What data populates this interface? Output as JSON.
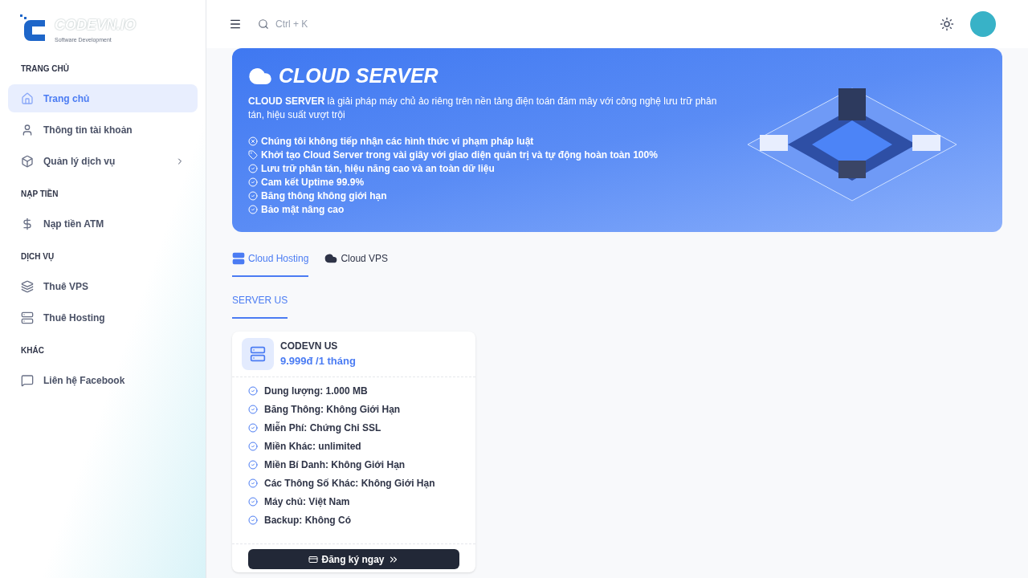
{
  "logo": {
    "name": "CODEVN.IO",
    "tagline": "Software Development"
  },
  "sidebar": {
    "sections": [
      {
        "title": "TRANG CHỦ",
        "items": [
          {
            "label": "Trang chủ",
            "selected": true,
            "has_children": false
          },
          {
            "label": "Thông tin tài khoản",
            "selected": false,
            "has_children": false
          },
          {
            "label": "Quản lý dịch vụ",
            "selected": false,
            "has_children": true
          }
        ]
      },
      {
        "title": "NẠP TIỀN",
        "items": [
          {
            "label": "Nạp tiền ATM",
            "selected": false,
            "has_children": false
          }
        ]
      },
      {
        "title": "DỊCH VỤ",
        "items": [
          {
            "label": "Thuê VPS",
            "selected": false,
            "has_children": false
          },
          {
            "label": "Thuê Hosting",
            "selected": false,
            "has_children": false
          }
        ]
      },
      {
        "title": "KHÁC",
        "items": [
          {
            "label": "Liên hệ Facebook",
            "selected": false,
            "has_children": false
          }
        ]
      }
    ]
  },
  "topbar": {
    "search": {
      "placeholder": "Ctrl + K"
    }
  },
  "banner": {
    "title": "CLOUD SERVER",
    "description": "**CLOUD SERVER** là giải pháp máy chủ ảo riêng trên nền tảng điện toán đám mây với công nghệ lưu trữ phân tán, hiệu suất vượt trội",
    "features": [
      {
        "kind": "ban",
        "text": "Chúng tôi không tiếp nhận các hình thức vi phạm pháp luật"
      },
      {
        "kind": "tag",
        "text": "Khởi tạo Cloud Server trong vài giây với giao diện quản trị và tự động hoàn toàn 100%"
      },
      {
        "kind": "check",
        "text": "Lưu trữ phân tán, hiệu năng cao và an toàn dữ liệu"
      },
      {
        "kind": "check",
        "text": "Cam kết Uptime 99.9%"
      },
      {
        "kind": "check",
        "text": "Băng thông không giới hạn"
      },
      {
        "kind": "check",
        "text": "Bảo mật nâng cao"
      }
    ]
  },
  "tabs": [
    {
      "label": "Cloud Hosting",
      "selected": true
    },
    {
      "label": "Cloud VPS",
      "selected": false
    }
  ],
  "subtabs": [
    {
      "label": "SERVER US",
      "selected": true
    }
  ],
  "plan": {
    "name": "CODEVN US",
    "price": "9.999đ /1 tháng",
    "features": [
      "Dung lượng: 1.000 MB",
      "Băng Thông: Không Giới Hạn",
      "Miễn Phí: Chứng Chỉ SSL",
      "Miền Khác: unlimited",
      "Miền Bí Danh: Không Giới Hạn",
      "Các Thông Số Khác: Không Giới Hạn",
      "Máy chủ: Việt Nam",
      "Backup: Không Có"
    ],
    "button": "Đăng ký ngay"
  }
}
